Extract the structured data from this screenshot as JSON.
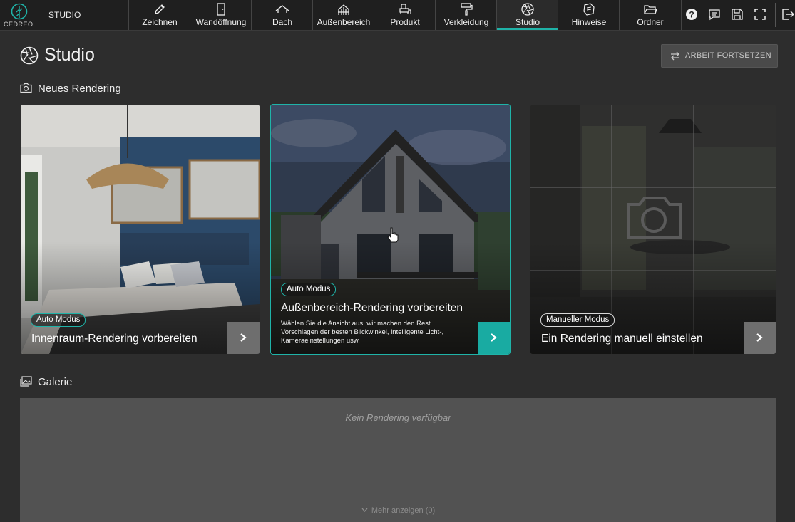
{
  "brand": {
    "name": "CEDREO",
    "app": "STUDIO",
    "accent": "#1fb3a8"
  },
  "nav": [
    {
      "label": "Zeichnen",
      "icon": "pencil-icon"
    },
    {
      "label": "Wandöffnung",
      "icon": "door-icon"
    },
    {
      "label": "Dach",
      "icon": "roof-icon"
    },
    {
      "label": "Außenbereich",
      "icon": "fence-icon"
    },
    {
      "label": "Produkt",
      "icon": "furniture-icon"
    },
    {
      "label": "Verkleidung",
      "icon": "paint-roller-icon"
    },
    {
      "label": "Studio",
      "icon": "aperture-icon",
      "active": true
    },
    {
      "label": "Hinweise",
      "icon": "note-icon"
    },
    {
      "label": "Ordner",
      "icon": "folder-icon"
    }
  ],
  "tools": [
    "help-icon",
    "comment-icon",
    "save-icon",
    "fullscreen-icon",
    "exit-icon"
  ],
  "page": {
    "title": "Studio",
    "continue_label": "ARBEIT FORTSETZEN"
  },
  "new_rendering": {
    "title": "Neues Rendering",
    "cards": [
      {
        "badge": "Auto Modus",
        "title": "Innenraum-Rendering vorbereiten"
      },
      {
        "badge": "Auto Modus",
        "title": "Außenbereich-Rendering vorbereiten",
        "desc": "Wählen Sie die Ansicht aus, wir machen den Rest. Vorschlagen der besten Blickwinkel, intelligente Licht-, Kameraeinstellungen usw.",
        "selected": true
      },
      {
        "badge": "Manueller Modus",
        "title": "Ein Rendering manuell einstellen"
      }
    ]
  },
  "gallery": {
    "title": "Galerie",
    "empty_text": "Kein Rendering verfügbar",
    "show_more": "Mehr anzeigen (0)"
  }
}
